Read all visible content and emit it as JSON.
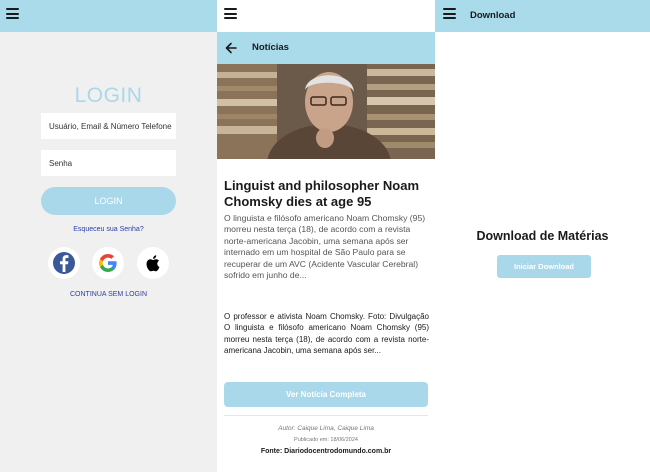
{
  "login_panel": {
    "title": "LOGIN",
    "username_placeholder": "Usuário, Email & Número Telefone",
    "password_placeholder": "Senha",
    "login_button": "LOGIN",
    "forgot_password": "Esqueceu sua Senha?",
    "social_icons": [
      "facebook-icon",
      "google-icon",
      "apple-icon"
    ],
    "continue_without_login": "CONTINUA SEM LOGIN"
  },
  "news_panel": {
    "header_title": "Notícias",
    "headline": "Linguist and philosopher Noam Chomsky dies at age 95",
    "lead": "O linguista e filósofo americano Noam Chomsky (95) morreu nesta terça (18), de acordo com a revista norte-americana Jacobin, uma semana após ser internado em um hospital de São Paulo para se recuperar de um AVC (Acidente Vascular Cerebral) sofrido em junho de...",
    "body": "O professor e ativista Noam Chomsky. Foto: Divulgação O linguista e filósofo americano Noam Chomsky (95) morreu nesta terça (18), de acordo com a revista norte-americana Jacobin, uma semana após ser...",
    "read_button": "Ver Notícia Completa",
    "author": "Autor: Caique Lima, Caique Lima",
    "published": "Publicado em: 18/06/2024",
    "source": "Fonte: Diariodocentrodomundo.com.br"
  },
  "download_panel": {
    "header_title": "Download",
    "heading": "Download de Matérias",
    "button": "Iniciar Download"
  },
  "colors": {
    "accent": "#aadbea",
    "link": "#2a3fa8",
    "login_bg": "#f0f0f0",
    "facebook": "#3b5998"
  }
}
